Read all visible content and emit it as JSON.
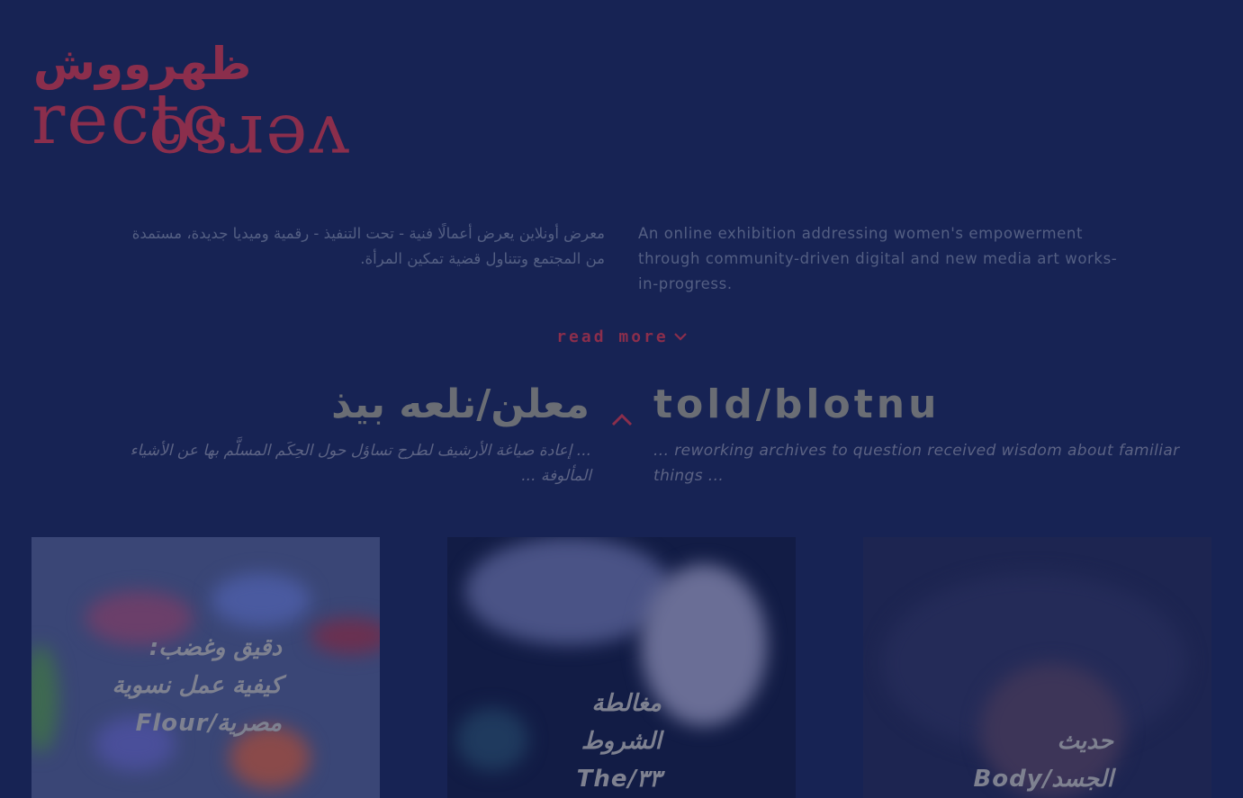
{
  "logo": {
    "arabic": "ظهرووش",
    "english": "recto",
    "english_reversed": "verso"
  },
  "intro": {
    "arabic": "معرض أونلاين يعرض أعمالًا فنية - تحت التنفيذ - رقمية وميديا جديدة، مستمدة من المجتمع وتتناول قضية تمكين المرأة.",
    "english": "An online exhibition addressing women's empowerment through community-driven digital and new media art works-in-progress."
  },
  "read_more": {
    "label": "read more"
  },
  "section": {
    "title_ar": "معلن/نلعه بيذ",
    "title_en": "told/blotnu",
    "subtitle_ar": "... إعادة صياغة الأرشيف لطرح تساؤل حول الحِكَم المسلَّم بها عن الأشياء المألوفة ...",
    "subtitle_en": "... reworking archives to question received wisdom about familiar things ..."
  },
  "cards": [
    {
      "title": "دقيق وغضب: كيفية عمل نسوية مصرية/Flour"
    },
    {
      "title": "مغالطة الشروط ٣٣/The"
    },
    {
      "title": "حديث الجسد/Body"
    }
  ],
  "colors": {
    "background": "#172354",
    "accent": "#8b2e4c",
    "muted_text": "#545f83"
  },
  "icons": {
    "read_more": "chevron-down-icon",
    "section": "caret-up-icon"
  }
}
